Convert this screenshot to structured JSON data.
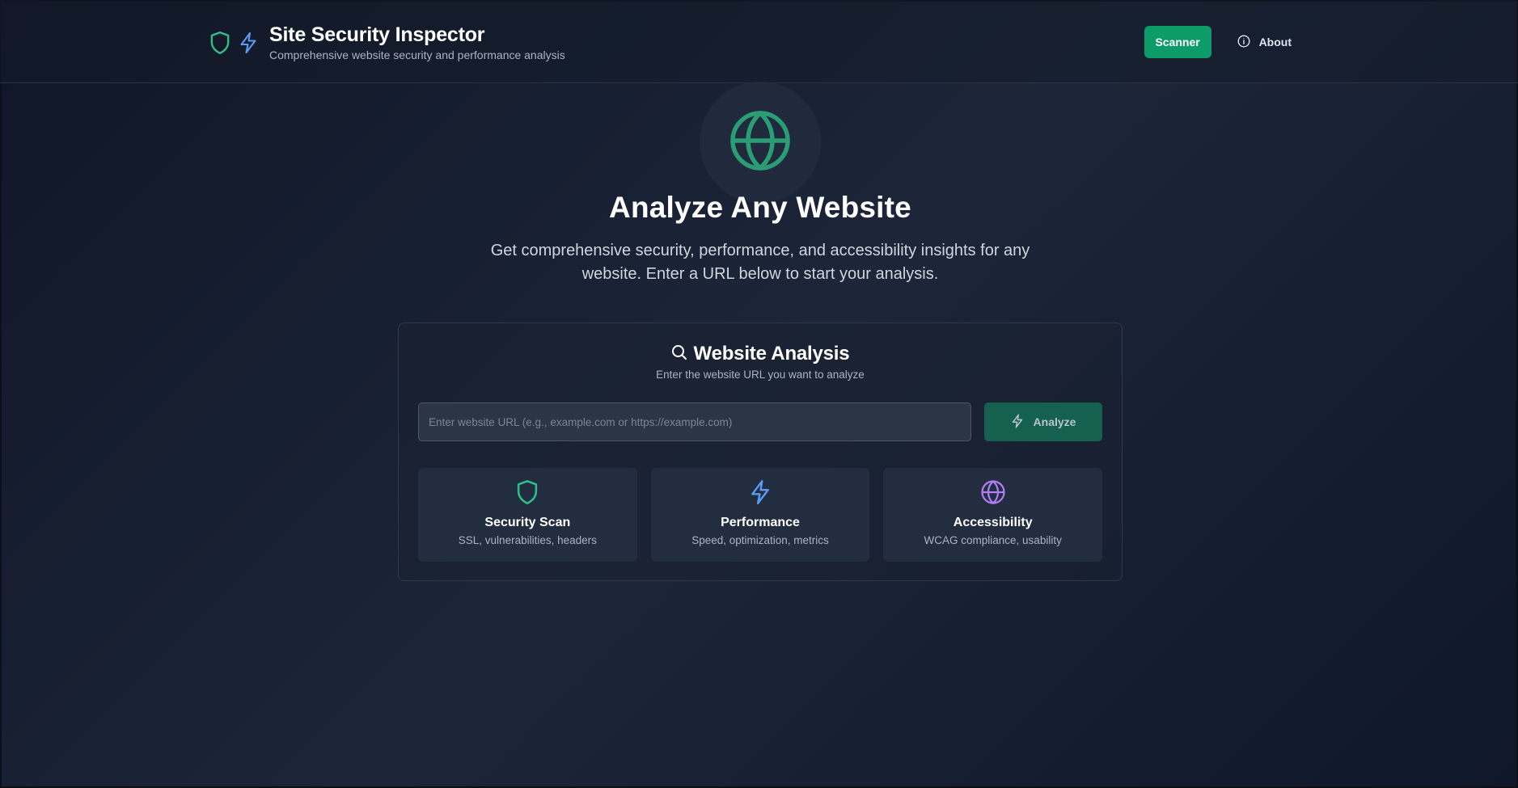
{
  "header": {
    "title": "Site Security Inspector",
    "subtitle": "Comprehensive website security and performance analysis",
    "nav": {
      "scanner_label": "Scanner",
      "about_label": "About"
    }
  },
  "hero": {
    "title": "Analyze Any Website",
    "description": "Get comprehensive security, performance, and accessibility insights for any website. Enter a URL below to start your analysis."
  },
  "analysis": {
    "title": "Website Analysis",
    "subtitle": "Enter the website URL you want to analyze",
    "input": {
      "placeholder": "Enter website URL (e.g., example.com or https://example.com)",
      "value": ""
    },
    "analyze_label": "Analyze",
    "features": [
      {
        "title": "Security Scan",
        "description": "SSL, vulnerabilities, headers",
        "icon": "shield-icon",
        "color": "#2fbf8a"
      },
      {
        "title": "Performance",
        "description": "Speed, optimization, metrics",
        "icon": "lightning-icon",
        "color": "#5b9bf3"
      },
      {
        "title": "Accessibility",
        "description": "WCAG compliance, usability",
        "icon": "globe-icon",
        "color": "#b07ef2"
      }
    ]
  },
  "colors": {
    "accent": "#0e9b6a",
    "shield": "#2fbf8a",
    "lightning": "#5b9bf3",
    "globe_hero": "#2a9d74",
    "globe_feature": "#b07ef2"
  }
}
